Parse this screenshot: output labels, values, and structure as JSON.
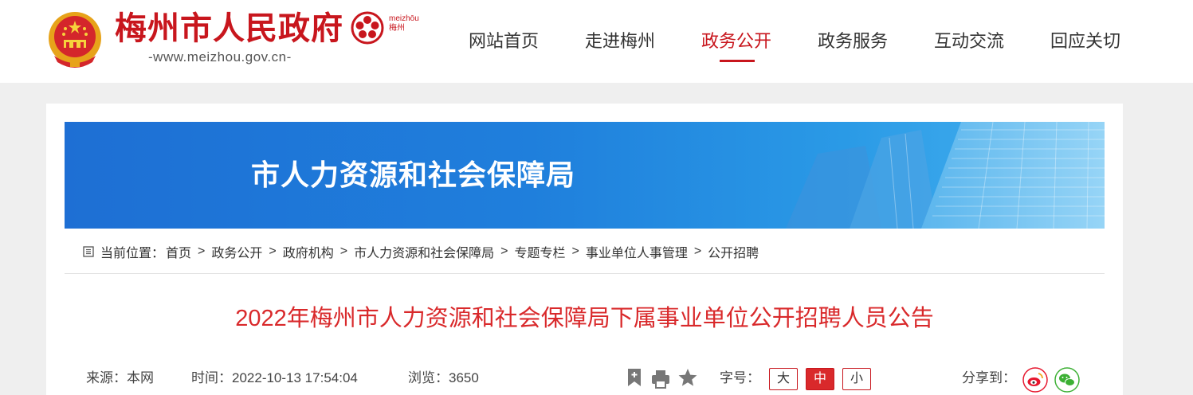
{
  "header": {
    "site_title": "梅州市人民政府",
    "site_url": "-www.meizhou.gov.cn-",
    "city_logo_text_1": "meizhōu",
    "city_logo_text_2": "梅州",
    "brand_color": "#c8161d"
  },
  "nav": {
    "items": [
      {
        "label": "网站首页"
      },
      {
        "label": "走进梅州"
      },
      {
        "label": "政务公开",
        "active": true
      },
      {
        "label": "政务服务"
      },
      {
        "label": "互动交流"
      },
      {
        "label": "回应关切"
      }
    ]
  },
  "banner": {
    "title": "市人力资源和社会保障局"
  },
  "breadcrumb": {
    "prefix": "当前位置：",
    "items": [
      "首页",
      "政务公开",
      "政府机构",
      "市人力资源和社会保障局",
      "专题专栏",
      "事业单位人事管理",
      "公开招聘"
    ],
    "separator": ">"
  },
  "article": {
    "title": "2022年梅州市人力资源和社会保障局下属事业单位公开招聘人员公告",
    "title_color": "#d9292b",
    "source": "来源：本网",
    "time": "时间：2022-10-13 17:54:04",
    "views": "浏览：3650",
    "font_size_label": "字号：",
    "font_sizes": [
      "大",
      "中",
      "小"
    ],
    "active_font_size": "中",
    "share_label": "分享到：",
    "tools": [
      "bookmark-icon",
      "print-icon",
      "star-icon"
    ],
    "share_targets": [
      "weibo-icon",
      "wechat-icon"
    ]
  }
}
